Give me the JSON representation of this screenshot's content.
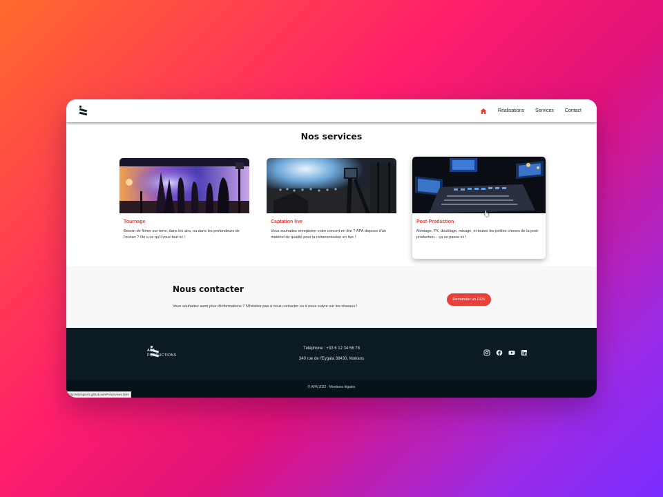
{
  "nav": {
    "home_icon": "home-icon",
    "links": [
      "Réalisations",
      "Services",
      "Contact"
    ],
    "accent": "#e8413a"
  },
  "services": {
    "title": "Nos services",
    "cards": [
      {
        "title": "Tournage",
        "text": "Besoin de filmer sur terre, dans les airs, ou dans les profondeurs de l'océan ? On a ce qu'il vous faut ici !",
        "image": "film-set-photo"
      },
      {
        "title": "Captation live",
        "text": "Vous souhaitez enregistrer votre concert en live ? APA dispose d'un matériel de qualité pour la retransmission en live !",
        "image": "live-concert-photo"
      },
      {
        "title": "Post-Production",
        "text": "Montage, FX, doublage, mixage, et toutes les petites choses de la post-production... ça se passe ici !",
        "image": "mixing-studio-photo"
      }
    ]
  },
  "contact": {
    "title": "Nous contacter",
    "text": "Vous souhaitez avoir plus d'informations ? N'hésitez pas à nous contacter ou à nous suivre sur les réseaux !",
    "button": "Demander un RDV"
  },
  "footer": {
    "logo_line1": "APA",
    "logo_line2": "PRODUCTIONS",
    "phone": "Téléphone : +33 6 12 34 56 78",
    "address": "340 rue de l'Eygala 38430, Moirans",
    "socials": [
      "instagram-icon",
      "facebook-icon",
      "youtube-icon",
      "linkedin-icon"
    ],
    "copyright": "© APA 2022 - Mentions légales",
    "background": "#0c1a24"
  },
  "status_url": "http://vbrispierts.github.io/APA/services.html"
}
